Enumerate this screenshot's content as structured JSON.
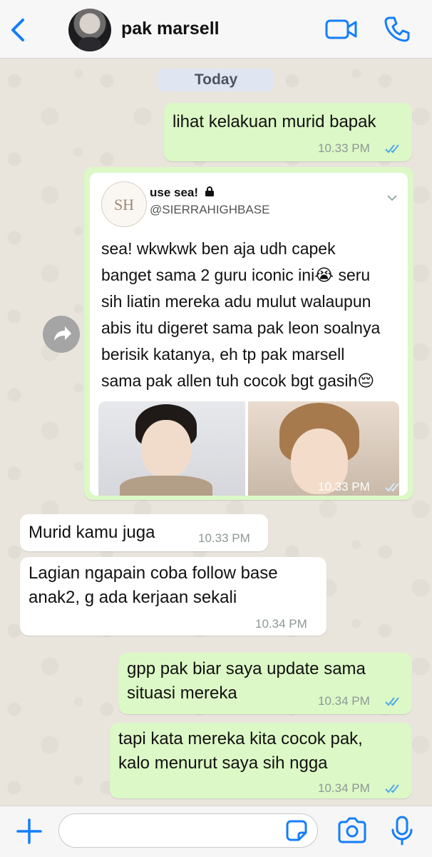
{
  "header": {
    "contact_name": "pak marsell",
    "back_icon": "chevron-left-icon",
    "video_icon": "video-camera-icon",
    "call_icon": "phone-icon"
  },
  "chat": {
    "date_label": "Today",
    "messages": [
      {
        "direction": "out",
        "text": "lihat kelakuan murid bapak",
        "time": "10.33 PM",
        "status": "read"
      },
      {
        "direction": "out",
        "type": "tweet-card",
        "time": "10.33 PM",
        "status": "read"
      },
      {
        "direction": "in",
        "text": "Murid kamu juga",
        "time": "10.33 PM"
      },
      {
        "direction": "in",
        "lines": [
          "Lagian ngapain coba follow base",
          "anak2, g ada kerjaan sekali"
        ],
        "time": "10.34 PM"
      },
      {
        "direction": "out",
        "lines": [
          "gpp pak biar saya update sama",
          "situasi mereka"
        ],
        "time": "10.34 PM",
        "status": "read"
      },
      {
        "direction": "out",
        "lines": [
          "tapi kata mereka kita cocok pak,",
          "kalo menurut saya sih ngga"
        ],
        "time": "10.34 PM",
        "status": "read"
      }
    ]
  },
  "tweet": {
    "logo_text": "SH",
    "name": "use sea!",
    "handle": "@SIERRAHIGHBASE",
    "lines": [
      "sea! wkwkwk ben aja udh capek",
      "banget sama 2 guru iconic ini😭 seru",
      "sih liatin mereka adu mulut walaupun",
      "abis itu digeret sama pak leon soalnya",
      "berisik katanya, eh tp pak marsell",
      "sama pak allen tuh cocok bgt gasih😔"
    ]
  },
  "composer": {
    "placeholder": ""
  },
  "colors": {
    "accent": "#147efb",
    "outgoing_bubble": "#dcf8c6",
    "incoming_bubble": "#ffffff",
    "read_ticks": "#4fa8e8"
  }
}
